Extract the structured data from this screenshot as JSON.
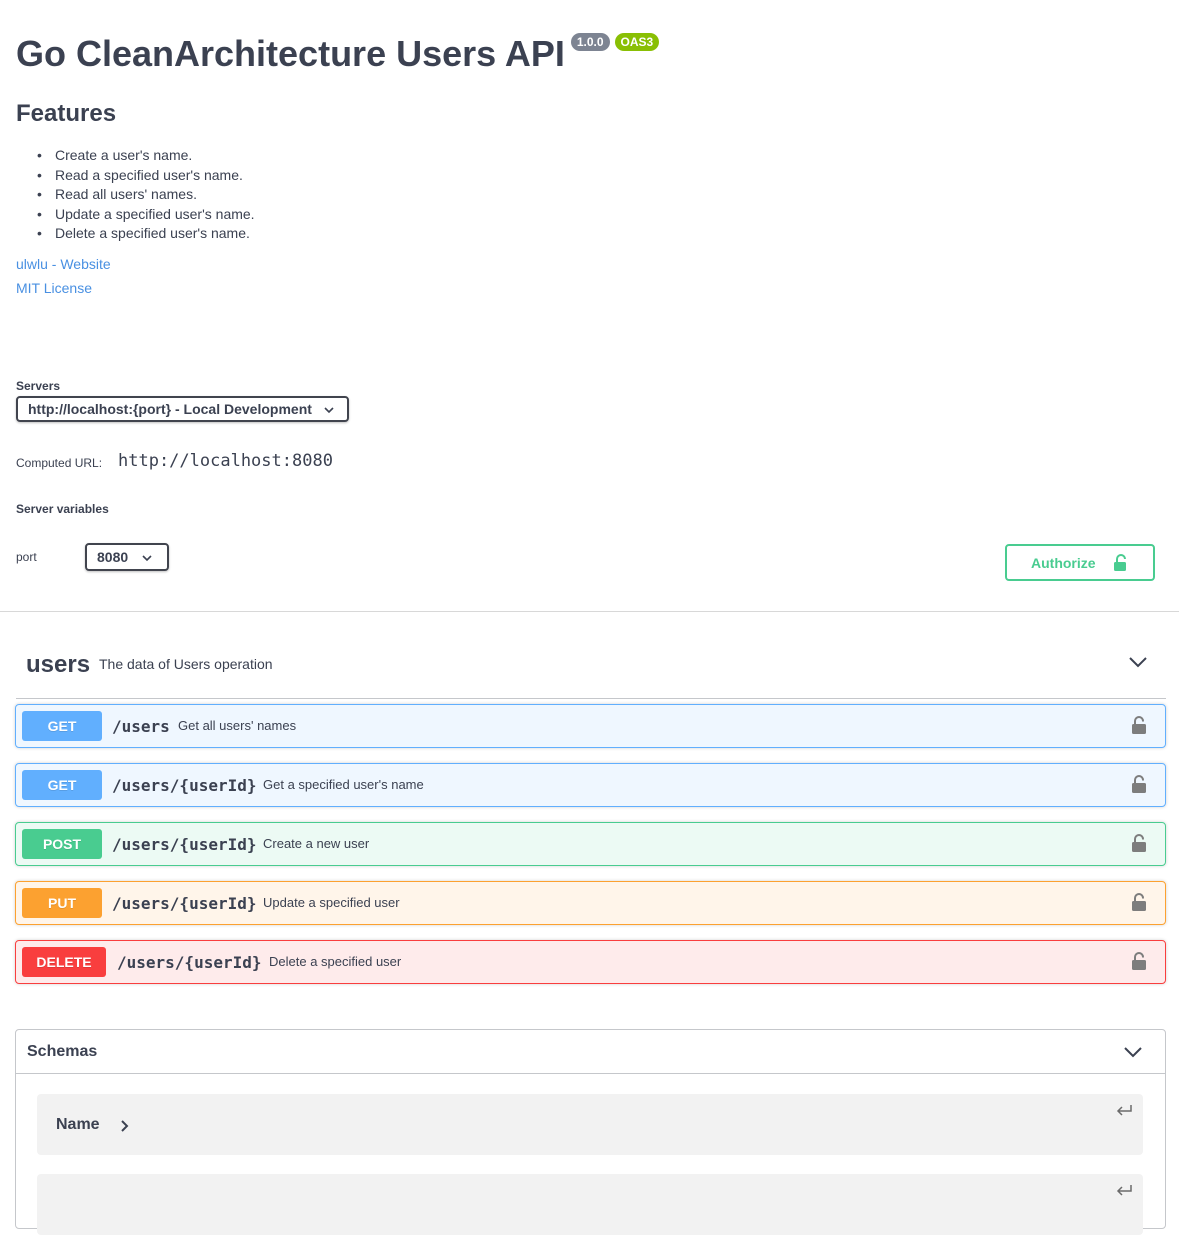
{
  "info": {
    "title": "Go CleanArchitecture Users API",
    "version_badge": "1.0.0",
    "oas_badge": "OAS3",
    "features_heading": "Features",
    "features": [
      "Create a user's name.",
      "Read a specified user's name.",
      "Read all users' names.",
      "Update a specified user's name.",
      "Delete a specified user's name."
    ],
    "website_link": "ulwlu - Website",
    "license_link": "MIT License"
  },
  "servers": {
    "label": "Servers",
    "selected": "http://localhost:{port} - Local Development",
    "computed_label": "Computed URL:",
    "computed_url": "http://localhost:8080",
    "variables_label": "Server variables",
    "port_label": "port",
    "port_value": "8080"
  },
  "authorize_label": "Authorize",
  "tag": {
    "name": "users",
    "description": "The data of Users operation"
  },
  "operations": [
    {
      "method": "GET",
      "path": "/users",
      "summary": "Get all users' names"
    },
    {
      "method": "GET",
      "path": "/users/{userId}",
      "summary": "Get a specified user's name"
    },
    {
      "method": "POST",
      "path": "/users/{userId}",
      "summary": "Create a new user"
    },
    {
      "method": "PUT",
      "path": "/users/{userId}",
      "summary": "Update a specified user"
    },
    {
      "method": "DELETE",
      "path": "/users/{userId}",
      "summary": "Delete a specified user"
    }
  ],
  "schemas": {
    "title": "Schemas",
    "models": [
      {
        "name": "Name"
      },
      {
        "name": ""
      }
    ]
  },
  "colors": {
    "get": "#61affe",
    "post": "#49cc90",
    "put": "#fca130",
    "delete": "#f93e3e",
    "authorize": "#49cc90",
    "link": "#4990e2"
  }
}
